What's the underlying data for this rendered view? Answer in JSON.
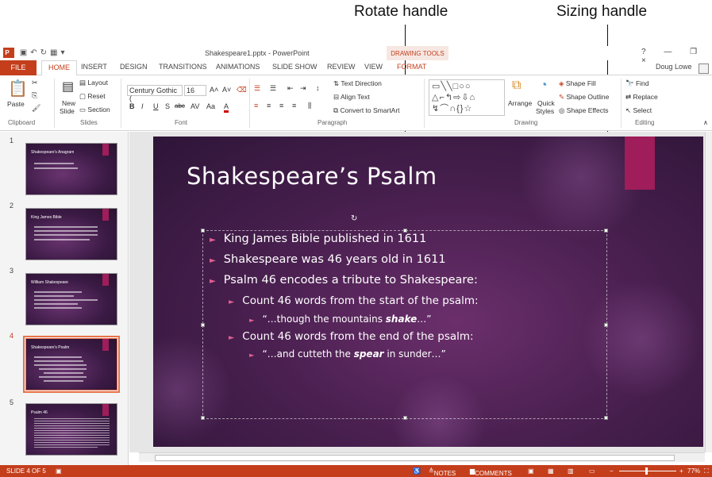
{
  "callouts": {
    "rotate": "Rotate handle",
    "sizing": "Sizing handle"
  },
  "titlebar": {
    "doc_title": "Shakespeare1.pptx - PowerPoint",
    "context_tab": "DRAWING TOOLS",
    "help": "?",
    "window_controls": "— ❐ ×"
  },
  "tabs": [
    "FILE",
    "HOME",
    "INSERT",
    "DESIGN",
    "TRANSITIONS",
    "ANIMATIONS",
    "SLIDE SHOW",
    "REVIEW",
    "VIEW",
    "FORMAT"
  ],
  "user": "Doug Lowe",
  "ribbon": {
    "clipboard": {
      "paste": "Paste",
      "label": "Clipboard"
    },
    "slides": {
      "new_slide": "New",
      "new_slide2": "Slide",
      "layout": "Layout",
      "reset": "Reset",
      "section": "Section",
      "label": "Slides"
    },
    "font": {
      "family": "Century Gothic (",
      "size": "16",
      "label": "Font",
      "bold": "B",
      "italic": "I",
      "underline": "U",
      "shadow": "S",
      "strike": "abc",
      "spacing": "AV",
      "case": "Aa",
      "color": "A",
      "grow": "A˄",
      "shrink": "A˅"
    },
    "paragraph": {
      "text_direction": "Text Direction",
      "align_text": "Align Text",
      "smartart": "Convert to SmartArt",
      "label": "Paragraph"
    },
    "drawing": {
      "arrange": "Arrange",
      "quick": "Quick",
      "styles": "Styles",
      "shape_fill": "Shape Fill",
      "shape_outline": "Shape Outline",
      "shape_effects": "Shape Effects",
      "label": "Drawing"
    },
    "editing": {
      "find": "Find",
      "replace": "Replace",
      "select": "Select",
      "label": "Editing"
    }
  },
  "thumbnails": [
    {
      "num": "1",
      "title": "Shakespeare's Anagram"
    },
    {
      "num": "2",
      "title": "King James Bible"
    },
    {
      "num": "3",
      "title": "William Shakespeare"
    },
    {
      "num": "4",
      "title": "Shakespeare's Psalm"
    },
    {
      "num": "5",
      "title": "Psalm 46"
    }
  ],
  "slide": {
    "title": "Shakespeare’s Psalm",
    "bullets": [
      "King James Bible published in 1611",
      "Shakespeare was 46 years old in 1611",
      "Psalm 46 encodes a tribute to Shakespeare:"
    ],
    "sub1": "Count 46 words from the start of the psalm:",
    "sub1_quote_pre": "“…though the mountains ",
    "sub1_quote_em": "shake",
    "sub1_quote_post": "…”",
    "sub2": "Count 46 words from the end of the psalm:",
    "sub2_quote_pre": "“…and cutteth the ",
    "sub2_quote_em": "spear",
    "sub2_quote_post": " in sunder…”"
  },
  "status": {
    "slide_counter": "SLIDE 4 OF 5",
    "notes": "NOTES",
    "comments": "COMMENTS",
    "zoom": "77%"
  },
  "colors": {
    "accent": "#c43e1c",
    "slide_bg": "#4a2050",
    "slide_tag": "#9e1d5a"
  }
}
